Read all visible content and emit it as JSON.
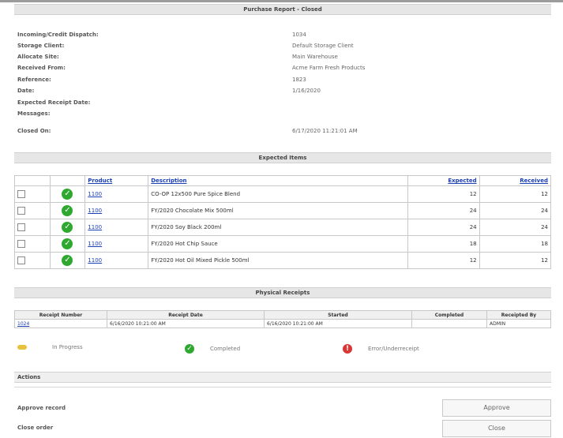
{
  "header": {
    "title": "Purchase Report - Closed"
  },
  "info": [
    {
      "label": "Incoming/Credit Dispatch:",
      "value": "1034"
    },
    {
      "label": "Storage Client:",
      "value": "Default Storage Client"
    },
    {
      "label": "Allocate Site:",
      "value": "Main Warehouse"
    },
    {
      "label": "Received From:",
      "value": "Acme Farm Fresh Products"
    },
    {
      "label": "Reference:",
      "value": "1823"
    },
    {
      "label": "Date:",
      "value": "1/16/2020"
    },
    {
      "label": "Expected Receipt Date:",
      "value": ""
    },
    {
      "label": "Messages:",
      "value": ""
    }
  ],
  "closed": {
    "label": "Closed On:",
    "value": "6/17/2020 11:21:01 AM"
  },
  "items_section": {
    "title": "Expected Items",
    "columns": [
      "",
      "",
      "Product",
      "Description",
      "Expected",
      "Received"
    ],
    "rows": [
      {
        "product": "1100",
        "description": "CO-OP 12x500 Pure Spice Blend",
        "expected": "12",
        "received": "12"
      },
      {
        "product": "1100",
        "description": "FY/2020 Chocolate Mix 500ml",
        "expected": "24",
        "received": "24"
      },
      {
        "product": "1100",
        "description": "FY/2020 Soy Black 200ml",
        "expected": "24",
        "received": "24"
      },
      {
        "product": "1100",
        "description": "FY/2020 Hot Chip Sauce",
        "expected": "18",
        "received": "18"
      },
      {
        "product": "1100",
        "description": "FY/2020 Hot Oil Mixed Pickle 500ml",
        "expected": "12",
        "received": "12"
      }
    ]
  },
  "receipts_section": {
    "title": "Physical Receipts",
    "columns": [
      "Receipt Number",
      "Receipt Date",
      "Started",
      "Completed",
      "Receipted By"
    ],
    "rows": [
      {
        "number": "1024",
        "date": "6/16/2020 10:21:00 AM",
        "started": "6/16/2020 10:21:00 AM",
        "completed": "",
        "by": "ADMIN"
      }
    ]
  },
  "legend": [
    {
      "label": "In Progress",
      "color": "#e8c23a",
      "icon": "in-progress-icon"
    },
    {
      "label": "Completed",
      "color": "#2fa82f",
      "icon": "completed-icon"
    },
    {
      "label": "Error/Underreceipt",
      "color": "#d93636",
      "icon": "error-icon"
    }
  ],
  "actions": {
    "title": "Actions",
    "approve_label": "Approve record",
    "approve_button": "Approve",
    "close_label": "Close order",
    "close_button": "Close"
  }
}
